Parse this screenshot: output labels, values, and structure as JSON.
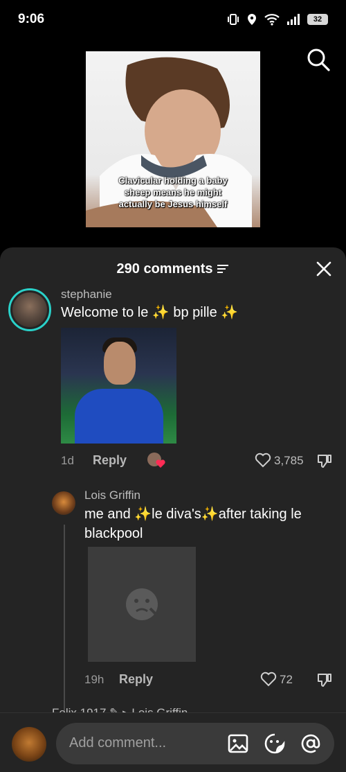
{
  "status_bar": {
    "time": "9:06",
    "battery": "32"
  },
  "video": {
    "caption": "Clavicular holding a baby sheep means he might actually be Jesus himself"
  },
  "sheet": {
    "title": "290 comments"
  },
  "comments": [
    {
      "username": "stephanie",
      "text": "Welcome to le ✨ bp pille ✨",
      "time": "1d",
      "reply_label": "Reply",
      "likes": "3,785"
    },
    {
      "username": "Lois Griffin",
      "text": "me and ✨le diva's✨after taking le blackpool",
      "time": "19h",
      "reply_label": "Reply",
      "likes": "72"
    }
  ],
  "next_comment_peek": "Felix 1917 ✎ ▸ Lois Griffin",
  "composer": {
    "placeholder": "Add comment..."
  },
  "icons": {
    "status": [
      "vibrate-icon",
      "location-icon",
      "wifi-icon",
      "signal-icon",
      "battery-icon"
    ],
    "search": "search-icon",
    "close": "close-icon",
    "sort": "sort-icon",
    "heart": "heart-icon",
    "dislike": "dislike-icon",
    "image": "image-icon",
    "sticker": "sticker-icon",
    "mention": "mention-icon"
  },
  "colors": {
    "sheet_bg": "#242424",
    "avatar_ring": "#2ad1c9"
  }
}
